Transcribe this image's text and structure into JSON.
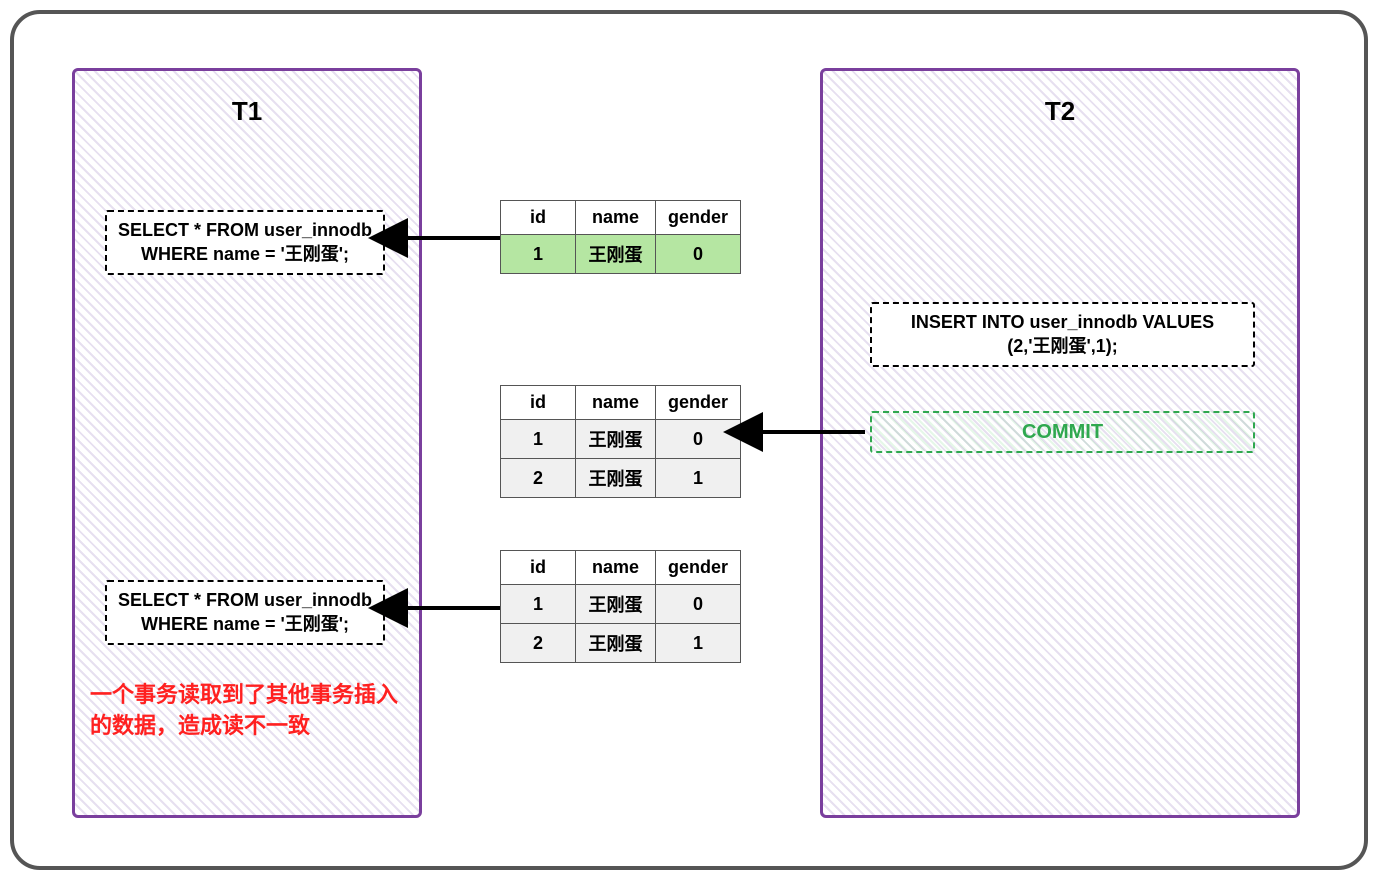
{
  "t1": {
    "title": "T1"
  },
  "t2": {
    "title": "T2"
  },
  "sql": {
    "select1_line1": "SELECT * FROM user_innodb",
    "select1_line2": "WHERE name = '王刚蛋';",
    "select2_line1": "SELECT * FROM user_innodb",
    "select2_line2": "WHERE name = '王刚蛋';",
    "insert_line1": "INSERT INTO user_innodb VALUES",
    "insert_line2": "(2,'王刚蛋',1);",
    "commit": "COMMIT"
  },
  "headers": {
    "id": "id",
    "name": "name",
    "gender": "gender"
  },
  "table1": {
    "rows": [
      {
        "id": "1",
        "name": "王刚蛋",
        "gender": "0"
      }
    ]
  },
  "table2": {
    "rows": [
      {
        "id": "1",
        "name": "王刚蛋",
        "gender": "0"
      },
      {
        "id": "2",
        "name": "王刚蛋",
        "gender": "1"
      }
    ]
  },
  "table3": {
    "rows": [
      {
        "id": "1",
        "name": "王刚蛋",
        "gender": "0"
      },
      {
        "id": "2",
        "name": "王刚蛋",
        "gender": "1"
      }
    ]
  },
  "warning": "一个事务读取到了其他事务插入的数据，造成读不一致"
}
